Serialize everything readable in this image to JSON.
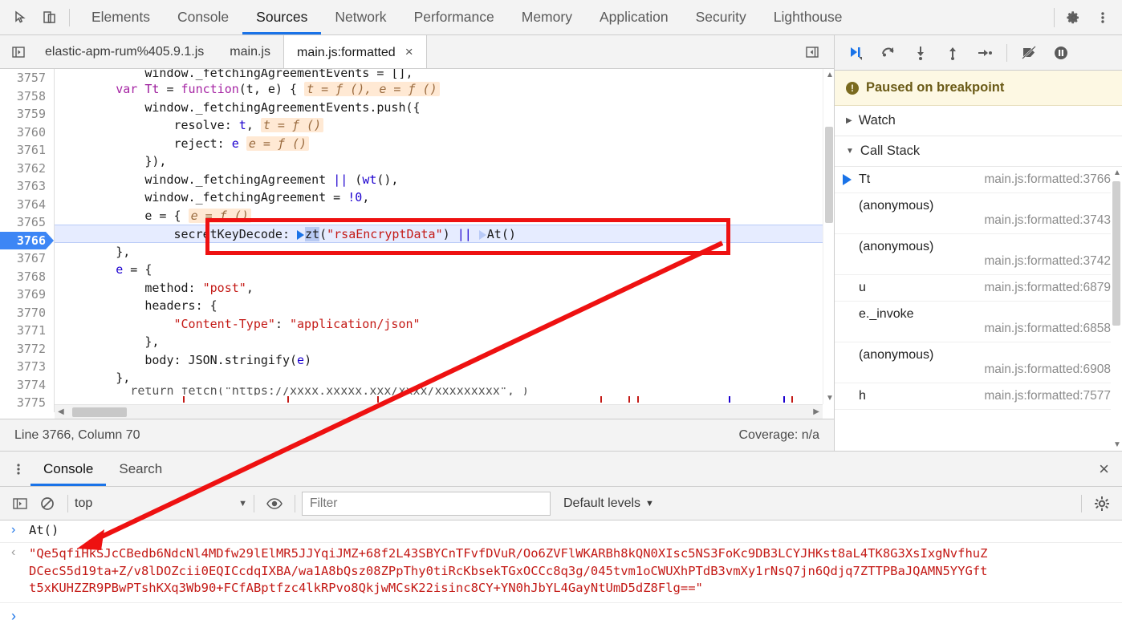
{
  "devtools": {
    "main_tabs": [
      {
        "label": "Elements",
        "active": false
      },
      {
        "label": "Console",
        "active": false
      },
      {
        "label": "Sources",
        "active": true
      },
      {
        "label": "Network",
        "active": false
      },
      {
        "label": "Performance",
        "active": false
      },
      {
        "label": "Memory",
        "active": false
      },
      {
        "label": "Application",
        "active": false
      },
      {
        "label": "Security",
        "active": false
      },
      {
        "label": "Lighthouse",
        "active": false
      }
    ],
    "inspect_icon": "inspect-element-icon",
    "device_icon": "device-toolbar-icon",
    "settings_icon": "gear-icon",
    "more_icon": "kebab-menu-icon"
  },
  "sources": {
    "file_tabs": [
      {
        "label": "elastic-apm-rum%405.9.1.js",
        "active": false,
        "closable": false
      },
      {
        "label": "main.js",
        "active": false,
        "closable": false
      },
      {
        "label": "main.js:formatted",
        "active": true,
        "closable": true
      }
    ],
    "close_glyph": "×",
    "navigator_toggle_icon": "show-navigator-icon",
    "panel_toggle_icon": "show-debugger-icon",
    "status": {
      "position": "Line 3766, Column 70",
      "coverage": "Coverage: n/a"
    },
    "code_lines": [
      {
        "n": "3757",
        "current": false,
        "clipped": true
      },
      {
        "n": "3758",
        "current": false
      },
      {
        "n": "3759",
        "current": false
      },
      {
        "n": "3760",
        "current": false
      },
      {
        "n": "3761",
        "current": false
      },
      {
        "n": "3762",
        "current": false
      },
      {
        "n": "3763",
        "current": false
      },
      {
        "n": "3764",
        "current": false
      },
      {
        "n": "3765",
        "current": false
      },
      {
        "n": "3766",
        "current": true
      },
      {
        "n": "3767",
        "current": false
      },
      {
        "n": "3768",
        "current": false
      },
      {
        "n": "3769",
        "current": false
      },
      {
        "n": "3770",
        "current": false
      },
      {
        "n": "3771",
        "current": false
      },
      {
        "n": "3772",
        "current": false
      },
      {
        "n": "3773",
        "current": false
      },
      {
        "n": "3774",
        "current": false
      },
      {
        "n": "3775",
        "current": false
      }
    ],
    "code_text": {
      "l3757": "window._fetchingAgreementEvents = [],",
      "l3758_a": "var ",
      "l3758_b": "Tt",
      "l3758_c": " = ",
      "l3758_d": "function",
      "l3758_e": "(t, e) { ",
      "l3758_hint": "t = ƒ (), e = ƒ ()",
      "l3759": "window._fetchingAgreementEvents.push({",
      "l3760_a": "resolve: ",
      "l3760_b": "t",
      "l3760_c": ", ",
      "l3760_hint": "t = ƒ ()",
      "l3761_a": "reject: ",
      "l3761_b": "e",
      "l3761_hint": "e = ƒ ()",
      "l3762": "}),",
      "l3763_a": "window._fetchingAgreement ",
      "l3763_b": "||",
      "l3763_c": " (",
      "l3763_d": "wt",
      "l3763_e": "(),",
      "l3764_a": "window._fetchingAgreement = ",
      "l3764_b": "!0",
      "l3764_c": ",",
      "l3765_a": "e = {",
      "l3765_hint": "e = ƒ ()",
      "l3766_a": "secretKeyDecode: ",
      "l3766_zt": "zt",
      "l3766_b": "(",
      "l3766_str": "\"rsaEncryptData\"",
      "l3766_c": ") ",
      "l3766_or": "||",
      "l3766_d": " ",
      "l3766_at": "At()",
      "l3767": "},",
      "l3768": "e = {",
      "l3769_a": "method: ",
      "l3769_b": "\"post\"",
      "l3769_c": ",",
      "l3770": "headers: {",
      "l3771_a": "\"Content-Type\"",
      "l3771_b": ": ",
      "l3771_c": "\"application/json\"",
      "l3772": "},",
      "l3773_a": "body: JSON.stringify(",
      "l3773_b": "e",
      "l3773_c": ")",
      "l3774": "},",
      "l3775": "  return fetch(\"https://xxxx.xxxxx.xxx/xxxx/xxxxxxxxx\", )"
    }
  },
  "debugger": {
    "toolbar_buttons": [
      {
        "name": "resume-script-execution",
        "icon": "resume-icon"
      },
      {
        "name": "step-over-next-function-call",
        "icon": "step-over-icon"
      },
      {
        "name": "step-into-next-function-call",
        "icon": "step-into-icon"
      },
      {
        "name": "step-out-of-current-function",
        "icon": "step-out-icon"
      },
      {
        "name": "step",
        "icon": "step-icon"
      },
      {
        "name": "deactivate-breakpoints",
        "icon": "deactivate-breakpoints-icon"
      },
      {
        "name": "pause-on-exceptions",
        "icon": "pause-on-exceptions-icon"
      }
    ],
    "paused_message": "Paused on breakpoint",
    "paused_icon": "info-icon",
    "sections": [
      {
        "label": "Watch",
        "expanded": false
      },
      {
        "label": "Call Stack",
        "expanded": true
      }
    ],
    "call_stack": [
      {
        "fn": "Tt",
        "loc": "main.js:formatted:3766",
        "selected": true
      },
      {
        "fn": "(anonymous)",
        "loc": "main.js:formatted:3743",
        "selected": false
      },
      {
        "fn": "(anonymous)",
        "loc": "main.js:formatted:3742",
        "selected": false
      },
      {
        "fn": "u",
        "loc": "main.js:formatted:6879",
        "selected": false
      },
      {
        "fn": "e._invoke",
        "loc": "main.js:formatted:6858",
        "selected": false
      },
      {
        "fn": "(anonymous)",
        "loc": "main.js:formatted:6908",
        "selected": false
      },
      {
        "fn": "h",
        "loc": "main.js:formatted:7577",
        "selected": false
      }
    ]
  },
  "drawer": {
    "tabs": [
      {
        "label": "Console",
        "active": true
      },
      {
        "label": "Search",
        "active": false
      }
    ],
    "more_icon": "kebab-menu-icon",
    "close_glyph": "×",
    "toolbar": {
      "sidebar_icon": "console-sidebar-icon",
      "clear_icon": "clear-console-icon",
      "context": "top",
      "context_caret": "▼",
      "eye_icon": "live-expression-icon",
      "filter_placeholder": "Filter",
      "filter_value": "",
      "levels_label": "Default levels",
      "levels_caret": "▼",
      "settings_icon": "gear-icon"
    },
    "entries": [
      {
        "kind": "input",
        "chevron": "›",
        "text": "At()"
      },
      {
        "kind": "output",
        "chevron": "‹",
        "text": "\"Qe5qfiHkSJcCBedb6NdcNl4MDfw29lElMR5JJYqiJMZ+68f2L43SBYCnTFvfDVuR/Oo6ZVFlWKARBh8kQN0XIsc5NS3FoKc9DB3LCYJHKst8aL4TK8G3XsIxgNvfhuZDCecS5d19ta+Z/v8lDOZcii0EQICcdqIXBA/wa1A8bQsz08ZPpThy0tiRcKbsekTGxOCCc8q3g/045tvm1oCWUXhPTdB3vmXy1rNsQ7jn6Qdjq7ZTTPBaJQAMN5YYGftt5xKUHZZR9PBwPTshKXq3Wb90+FCfABptfzc4lkRPvo8QkjwMCsK22isinc8CY+YN0hJbYL4GayNtUmD5dZ8Flg==\""
      }
    ],
    "prompt_chevron": "›"
  },
  "annotation": {
    "box_color": "#ee1111",
    "arrow_color": "#ee1111",
    "highlights_line": "3766",
    "points_to": "console input At()"
  }
}
